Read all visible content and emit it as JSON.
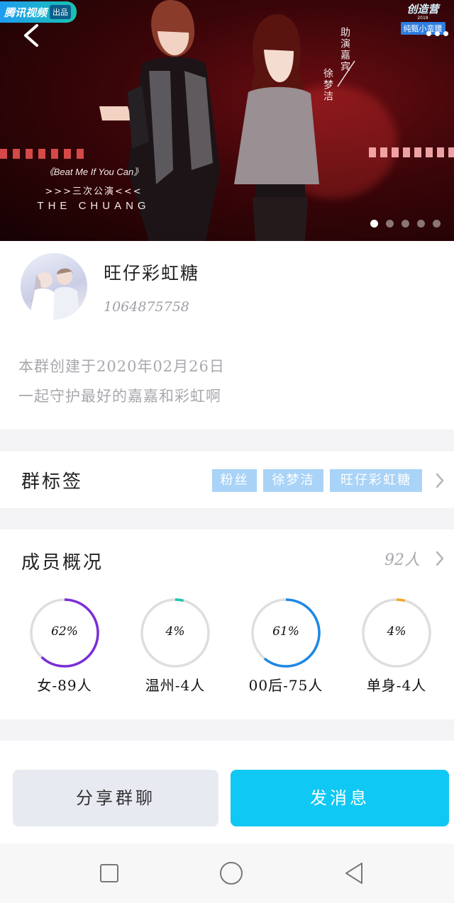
{
  "banner": {
    "source_name": "腾讯视频",
    "source_tag": "出品",
    "event_logo": {
      "name": "创造营",
      "year": "2019",
      "sponsor": "纯甄小蛮腰"
    },
    "guest_label": "助演嘉宾",
    "guest_name": "徐梦洁",
    "song": "《Beat Me If You Can》",
    "episode": ">>>三次公演<<<",
    "brand": "THE CHUANG",
    "slide_count": 5,
    "active_slide": 1
  },
  "group": {
    "name": "旺仔彩虹糖",
    "id": "1064875758",
    "description_line1": "本群创建于2020年02月26日",
    "description_line2": "一起守护最好的嘉嘉和彩虹啊"
  },
  "tags": {
    "label": "群标签",
    "items": [
      "粉丝",
      "徐梦洁",
      "旺仔彩虹糖"
    ]
  },
  "members": {
    "title": "成员概况",
    "count": "92人",
    "stats": [
      {
        "percent": "62%",
        "fraction": 0.62,
        "caption": "女-89人",
        "color": "#7b2fd6"
      },
      {
        "percent": "4%",
        "fraction": 0.04,
        "caption": "温州-4人",
        "color": "#19c7b0"
      },
      {
        "percent": "61%",
        "fraction": 0.61,
        "caption": "00后-75人",
        "color": "#1e88e5"
      },
      {
        "percent": "4%",
        "fraction": 0.04,
        "caption": "单身-4人",
        "color": "#f5a623"
      }
    ]
  },
  "actions": {
    "share_label": "分享群聊",
    "send_label": "发消息"
  },
  "colors": {
    "accent": "#10c8f4",
    "tag_chip": "#a9d3f7"
  },
  "icons": {
    "back": "chevron-left-icon",
    "more": "more-dots-icon",
    "chevron": "chevron-right-icon",
    "nav_recent": "square-icon",
    "nav_home": "circle-icon",
    "nav_back": "triangle-back-icon"
  }
}
